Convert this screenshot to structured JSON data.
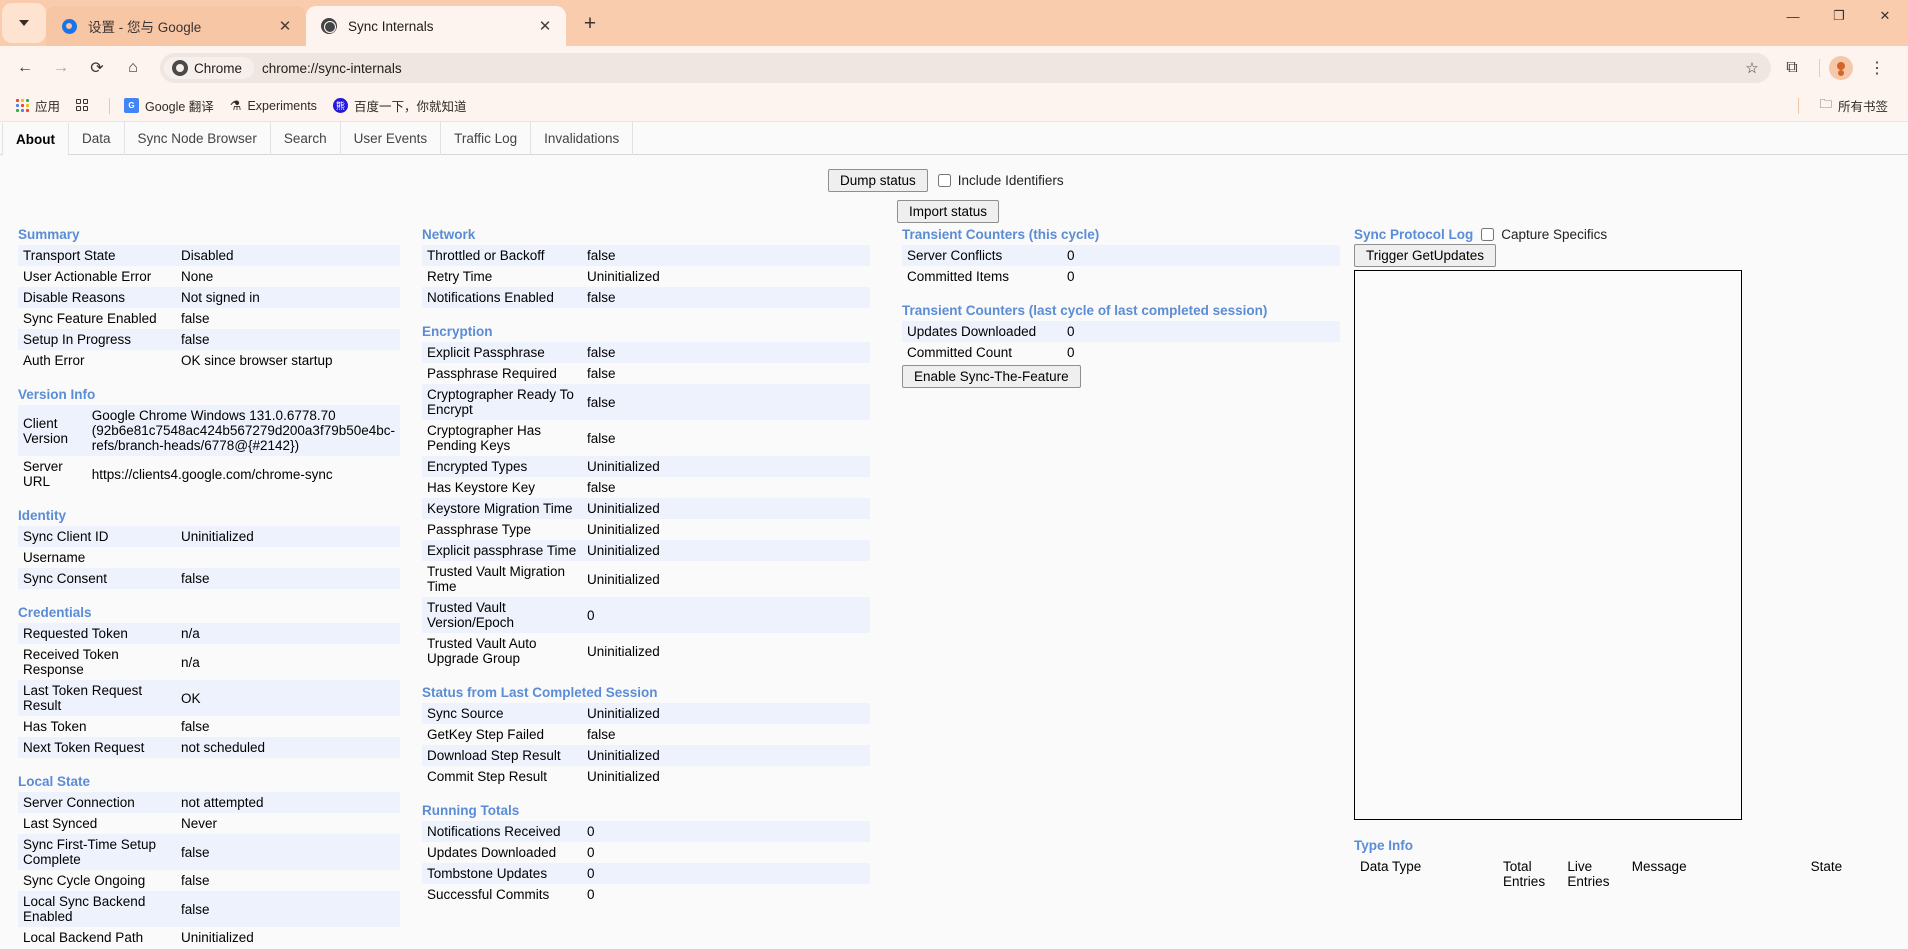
{
  "browser": {
    "tabs": [
      {
        "title": "设置 - 您与 Google",
        "icon": "gear-icon",
        "active": false
      },
      {
        "title": "Sync Internals",
        "icon": "globe-icon",
        "active": true
      }
    ],
    "newtab_label": "+",
    "window_controls": {
      "minimize": "—",
      "maximize": "❐",
      "close": "✕"
    },
    "toolbar": {
      "back": "←",
      "forward": "→",
      "reload": "⟳",
      "home": "⌂",
      "chrome_chip_label": "Chrome",
      "url": "chrome://sync-internals",
      "bookmark_star": "☆",
      "extensions": "⧉",
      "menu": "⋮"
    },
    "bookmarks": [
      {
        "label": "应用",
        "icon": "apps-grid-icon"
      },
      {
        "label": "",
        "icon": "squares-icon"
      },
      {
        "label": "Google 翻译",
        "icon": "google-translate-icon"
      },
      {
        "label": "Experiments",
        "icon": "flask-icon"
      },
      {
        "label": "百度一下，你就知道",
        "icon": "baidu-icon"
      }
    ],
    "bookmarks_right": {
      "label": "所有书签",
      "icon": "folder-icon"
    }
  },
  "page": {
    "tabs": [
      {
        "label": "About",
        "selected": true
      },
      {
        "label": "Data",
        "selected": false
      },
      {
        "label": "Sync Node Browser",
        "selected": false
      },
      {
        "label": "Search",
        "selected": false
      },
      {
        "label": "User Events",
        "selected": false
      },
      {
        "label": "Traffic Log",
        "selected": false
      },
      {
        "label": "Invalidations",
        "selected": false
      }
    ],
    "actions": {
      "dump_status": "Dump status",
      "include_identifiers": "Include Identifiers",
      "import_status": "Import status",
      "enable_sync_the_feature": "Enable Sync-The-Feature",
      "trigger_get_updates": "Trigger GetUpdates",
      "capture_specifics": "Capture Specifics"
    },
    "sections": {
      "summary": {
        "title": "Summary",
        "rows": [
          {
            "k": "Transport State",
            "v": "Disabled"
          },
          {
            "k": "User Actionable Error",
            "v": "None"
          },
          {
            "k": "Disable Reasons",
            "v": "Not signed in"
          },
          {
            "k": "Sync Feature Enabled",
            "v": "false"
          },
          {
            "k": "Setup In Progress",
            "v": "false"
          },
          {
            "k": "Auth Error",
            "v": "OK since browser startup"
          }
        ]
      },
      "version_info": {
        "title": "Version Info",
        "rows": [
          {
            "k": "Client Version",
            "v": "Google Chrome Windows 131.0.6778.70 (92b6e81c7548ac424b567279d200a3f79b50e4bc-refs/branch-heads/6778@{#2142})"
          },
          {
            "k": "Server URL",
            "v": "https://clients4.google.com/chrome-sync"
          }
        ]
      },
      "identity": {
        "title": "Identity",
        "rows": [
          {
            "k": "Sync Client ID",
            "v": "Uninitialized",
            "muted": true
          },
          {
            "k": "Username",
            "v": ""
          },
          {
            "k": "Sync Consent",
            "v": "false"
          }
        ]
      },
      "credentials": {
        "title": "Credentials",
        "rows": [
          {
            "k": "Requested Token",
            "v": "n/a"
          },
          {
            "k": "Received Token Response",
            "v": "n/a"
          },
          {
            "k": "Last Token Request Result",
            "v": "OK"
          },
          {
            "k": "Has Token",
            "v": "false"
          },
          {
            "k": "Next Token Request",
            "v": "not scheduled"
          }
        ]
      },
      "local_state": {
        "title": "Local State",
        "rows": [
          {
            "k": "Server Connection",
            "v": "not attempted"
          },
          {
            "k": "Last Synced",
            "v": "Never"
          },
          {
            "k": "Sync First-Time Setup Complete",
            "v": "false"
          },
          {
            "k": "Sync Cycle Ongoing",
            "v": "false",
            "muted": true
          },
          {
            "k": "Local Sync Backend Enabled",
            "v": "false"
          },
          {
            "k": "Local Backend Path",
            "v": "Uninitialized",
            "muted": true
          }
        ]
      },
      "network": {
        "title": "Network",
        "rows": [
          {
            "k": "Throttled or Backoff",
            "v": "false",
            "muted": true
          },
          {
            "k": "Retry Time",
            "v": "Uninitialized",
            "muted": true
          },
          {
            "k": "Notifications Enabled",
            "v": "false",
            "muted": true
          }
        ]
      },
      "encryption": {
        "title": "Encryption",
        "rows": [
          {
            "k": "Explicit Passphrase",
            "v": "false",
            "muted": true
          },
          {
            "k": "Passphrase Required",
            "v": "false",
            "muted": true
          },
          {
            "k": "Cryptographer Ready To Encrypt",
            "v": "false",
            "muted": true
          },
          {
            "k": "Cryptographer Has Pending Keys",
            "v": "false",
            "muted": true
          },
          {
            "k": "Encrypted Types",
            "v": "Uninitialized",
            "muted": true
          },
          {
            "k": "Has Keystore Key",
            "v": "false",
            "muted": true
          },
          {
            "k": "Keystore Migration Time",
            "v": "Uninitialized",
            "muted": true
          },
          {
            "k": "Passphrase Type",
            "v": "Uninitialized",
            "muted": true
          },
          {
            "k": "Explicit passphrase Time",
            "v": "Uninitialized",
            "muted": true
          },
          {
            "k": "Trusted Vault Migration Time",
            "v": "Uninitialized",
            "muted": true
          },
          {
            "k": "Trusted Vault Version/Epoch",
            "v": "0",
            "muted": true
          },
          {
            "k": "Trusted Vault Auto Upgrade Group",
            "v": "Uninitialized",
            "muted": true
          }
        ]
      },
      "last_session": {
        "title": "Status from Last Completed Session",
        "rows": [
          {
            "k": "Sync Source",
            "v": "Uninitialized",
            "muted": true
          },
          {
            "k": "GetKey Step Failed",
            "v": "false",
            "muted": true
          },
          {
            "k": "Download Step Result",
            "v": "Uninitialized",
            "muted": true
          },
          {
            "k": "Commit Step Result",
            "v": "Uninitialized",
            "muted": true
          }
        ]
      },
      "running_totals": {
        "title": "Running Totals",
        "rows": [
          {
            "k": "Notifications Received",
            "v": "0",
            "muted": true
          },
          {
            "k": "Updates Downloaded",
            "v": "0",
            "muted": true
          },
          {
            "k": "Tombstone Updates",
            "v": "0",
            "muted": true
          },
          {
            "k": "Successful Commits",
            "v": "0",
            "muted": true
          }
        ]
      },
      "transient_this_cycle": {
        "title": "Transient Counters (this cycle)",
        "rows": [
          {
            "k": "Server Conflicts",
            "v": "0",
            "muted": true
          },
          {
            "k": "Committed Items",
            "v": "0",
            "muted": true
          }
        ]
      },
      "transient_last_cycle": {
        "title": "Transient Counters (last cycle of last completed session)",
        "rows": [
          {
            "k": "Updates Downloaded",
            "v": "0",
            "muted": true
          },
          {
            "k": "Committed Count",
            "v": "0",
            "muted": true
          }
        ]
      },
      "protocol_log": {
        "title": "Sync Protocol Log",
        "content": ""
      },
      "type_info": {
        "title": "Type Info",
        "headers": [
          "Data Type",
          "Total Entries",
          "Live Entries",
          "Message",
          "State"
        ],
        "rows": []
      }
    }
  }
}
